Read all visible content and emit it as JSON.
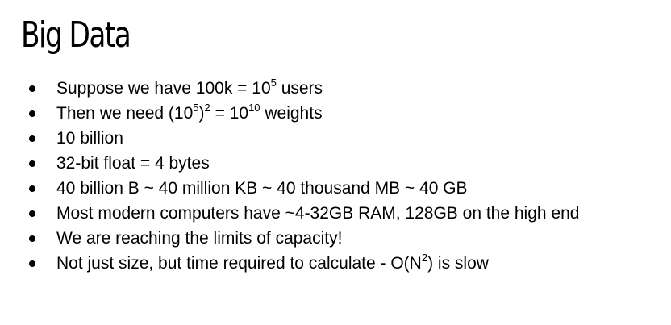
{
  "slide": {
    "title": "Big Data",
    "bullets": [
      {
        "parts": [
          {
            "t": "Suppose we have 100k = 10"
          },
          {
            "t": "5",
            "sup": true
          },
          {
            "t": " users"
          }
        ]
      },
      {
        "parts": [
          {
            "t": "Then we need (10"
          },
          {
            "t": "5",
            "sup": true
          },
          {
            "t": ")"
          },
          {
            "t": "2",
            "sup": true
          },
          {
            "t": " = 10"
          },
          {
            "t": "10",
            "sup": true
          },
          {
            "t": " weights"
          }
        ]
      },
      {
        "parts": [
          {
            "t": "10 billion"
          }
        ]
      },
      {
        "parts": [
          {
            "t": "32-bit float = 4 bytes"
          }
        ]
      },
      {
        "parts": [
          {
            "t": "40 billion B ~ 40 million KB ~ 40 thousand MB ~ 40 GB"
          }
        ]
      },
      {
        "parts": [
          {
            "t": "Most modern computers have ~4-32GB RAM, 128GB on the high end"
          }
        ]
      },
      {
        "parts": [
          {
            "t": "We are reaching the limits of capacity!"
          }
        ]
      },
      {
        "parts": [
          {
            "t": "Not just size, but time required to calculate - O(N"
          },
          {
            "t": "2",
            "sup": true
          },
          {
            "t": ") is slow"
          }
        ]
      }
    ]
  }
}
